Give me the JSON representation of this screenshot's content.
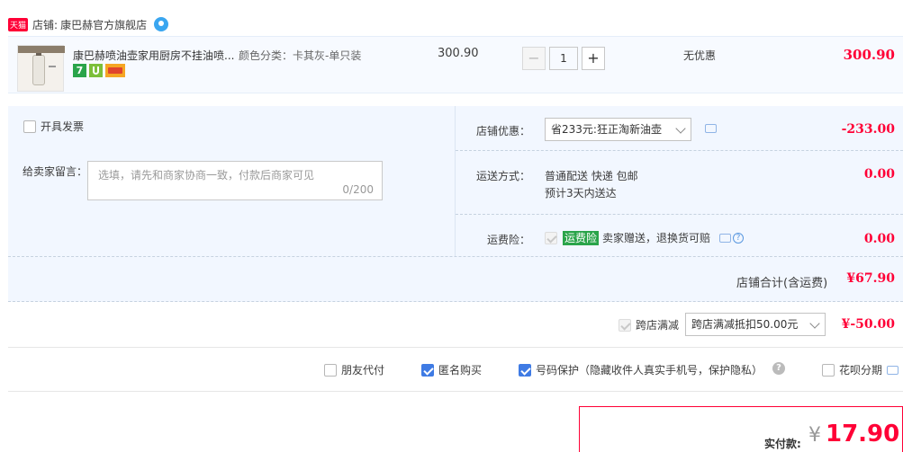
{
  "shop": {
    "badge": "天猫",
    "label": "店铺:",
    "name": "康巴赫官方旗舰店"
  },
  "item": {
    "title": "康巴赫喷油壶家用厨房不挂油喷...",
    "sku": "颜色分类：卡其灰-单只装",
    "unit_price": "300.90",
    "quantity": "1",
    "discount": "无优惠",
    "subtotal": "300.90",
    "service_icons": [
      "7-day-return-icon",
      "guarantee-icon",
      "credit-card-icon"
    ],
    "service_badge_text": "7"
  },
  "invoice": {
    "label": "开具发票"
  },
  "message": {
    "label": "给卖家留言：",
    "placeholder": "选填，请先和商家协商一致，付款后商家可见",
    "counter": "0/200"
  },
  "shop_discount": {
    "label": "店铺优惠：",
    "selected": "省233元:狂正淘新油壶",
    "amount": "-233.00"
  },
  "shipping": {
    "label": "运送方式：",
    "method": "普通配送 快递 包邮",
    "eta": "预计3天内送达",
    "amount": "0.00"
  },
  "freight_insurance": {
    "label": "运费险：",
    "tag": "运费险",
    "text": "卖家赠送，退换货可赔",
    "amount": "0.00"
  },
  "shop_total": {
    "label": "店铺合计(含运费)",
    "amount": "¥67.90"
  },
  "cross_store": {
    "label": "跨店满减",
    "selected": "跨店满减抵扣50.00元",
    "amount": "¥-50.00"
  },
  "options": {
    "friend_pay": "朋友代付",
    "anonymous": "匿名购买",
    "number_protect": "号码保护（隐藏收件人真实手机号，保护隐私）",
    "huabei": "花呗分期"
  },
  "actual": {
    "label": "实付款:",
    "currency": "¥",
    "amount": "17.90"
  },
  "colors": {
    "accent_red": "#ff0036",
    "panel_blue": "#f2f7ff",
    "check_blue": "#3f7be4",
    "insurance_green": "#2aa44a"
  }
}
